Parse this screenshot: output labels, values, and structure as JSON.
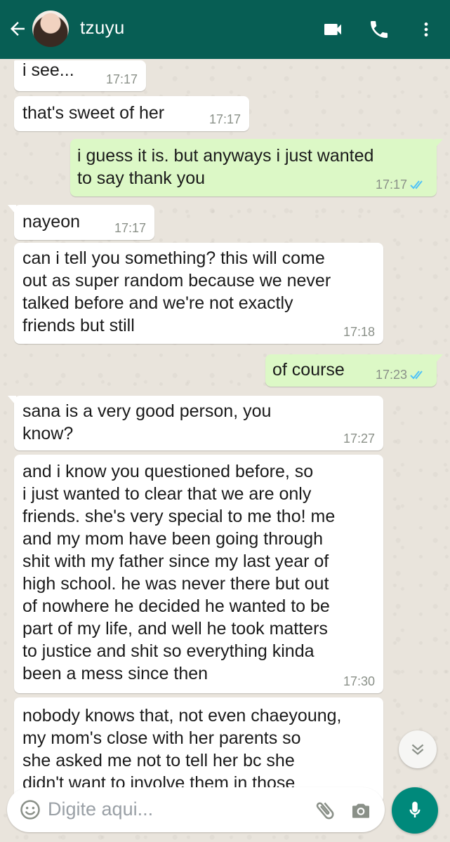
{
  "header": {
    "contact_name": "tzuyu",
    "icons": [
      "back-arrow-icon",
      "video-call-icon",
      "phone-icon",
      "more-options-icon"
    ]
  },
  "messages": [
    {
      "side": "in",
      "text": "i see...",
      "time": "17:17"
    },
    {
      "side": "in",
      "text": "that's sweet of her",
      "time": "17:17"
    },
    {
      "side": "out",
      "text": "i guess it is. but anyways i just wanted\nto say thank you",
      "time": "17:17",
      "status": "read"
    },
    {
      "side": "in",
      "text": "nayeon",
      "time": "17:17"
    },
    {
      "side": "in",
      "text": "can i tell you something? this will come\nout as super random because we never\ntalked before and we're not exactly\nfriends but still",
      "time": "17:18"
    },
    {
      "side": "out",
      "text": "of course",
      "time": "17:23",
      "status": "read"
    },
    {
      "side": "in",
      "text": "sana is a very good person, you\nknow?",
      "time": "17:27"
    },
    {
      "side": "in",
      "text": "and i know you questioned before, so\ni just wanted to clear that we are only\nfriends. she's very special to me tho! me\nand my mom have been going through\nshit with my father since my last year of\nhigh school. he was never there but out\nof nowhere he decided he wanted to be\npart of my life, and well he took matters\nto justice and shit so everything kinda\nbeen a mess since then",
      "time": "17:30"
    },
    {
      "side": "in",
      "text": "nobody knows that, not even chaeyoung,\nmy mom's close with her parents so\nshe asked me not to tell her bc she\ndidn't want to involve them in those",
      "time": ""
    }
  ],
  "input": {
    "placeholder": "Digite aqui...",
    "icons": [
      "emoji-icon",
      "attach-icon",
      "camera-icon",
      "microphone-icon"
    ]
  },
  "colors": {
    "header": "#075e54",
    "outgoing_bubble": "#dcf8c6",
    "incoming_bubble": "#ffffff",
    "read_ticks": "#4fc3f7",
    "mic_button": "#00897b"
  }
}
